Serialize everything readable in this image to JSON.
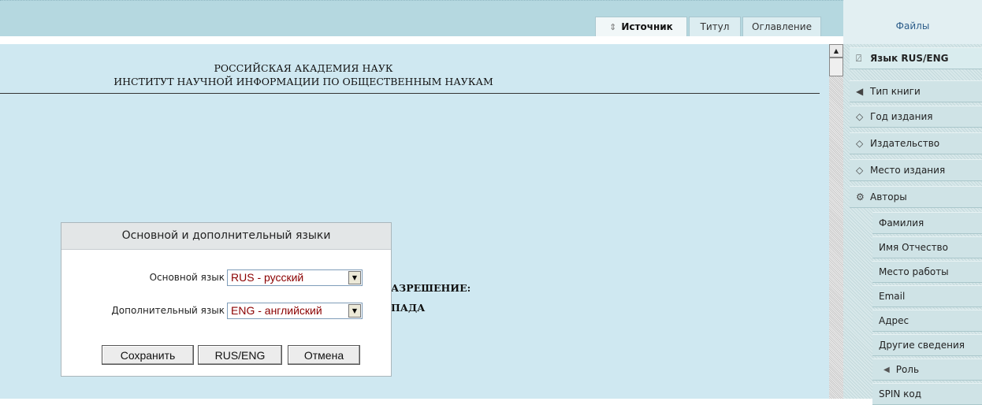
{
  "tabs": [
    {
      "label": "Источник",
      "icon": "sort-arrows-icon",
      "active": true
    },
    {
      "label": "Титул",
      "active": false
    },
    {
      "label": "Оглавление",
      "active": false
    }
  ],
  "files_label": "Файлы",
  "document": {
    "line1": "РОССИЙСКАЯ АКАДЕМИЯ НАУК",
    "line2": "ИНСТИТУТ НАУЧНОЙ ИНФОРМАЦИИ ПО ОБЩЕСТВЕННЫМ НАУКАМ",
    "partial1": "АЗРЕШЕНИЕ:",
    "partial2": "ПАДА"
  },
  "sidebar": {
    "items": [
      {
        "label": "Язык RUS/ENG",
        "icon": "language-icon"
      },
      {
        "label": "Тип книги",
        "icon": "triangle-left-icon"
      },
      {
        "label": "Год издания",
        "icon": "tag-icon"
      },
      {
        "label": "Издательство",
        "icon": "tag-icon"
      },
      {
        "label": "Место издания",
        "icon": "tag-icon"
      },
      {
        "label": "Авторы",
        "icon": "gear-icon"
      }
    ],
    "author_fields": [
      "Фамилия",
      "Имя Отчество",
      "Место работы",
      "Email",
      "Адрес",
      "Другие сведения"
    ],
    "role_label": "Роль",
    "spin_label": "SPIN код"
  },
  "dialog": {
    "title": "Основной и дополнительный языки",
    "primary_label": "Основной язык",
    "primary_value": "RUS - русский",
    "secondary_label": "Дополнительный язык",
    "secondary_value": "ENG - английский",
    "save": "Сохранить",
    "rus_eng": "RUS/ENG",
    "cancel": "Отмена"
  }
}
